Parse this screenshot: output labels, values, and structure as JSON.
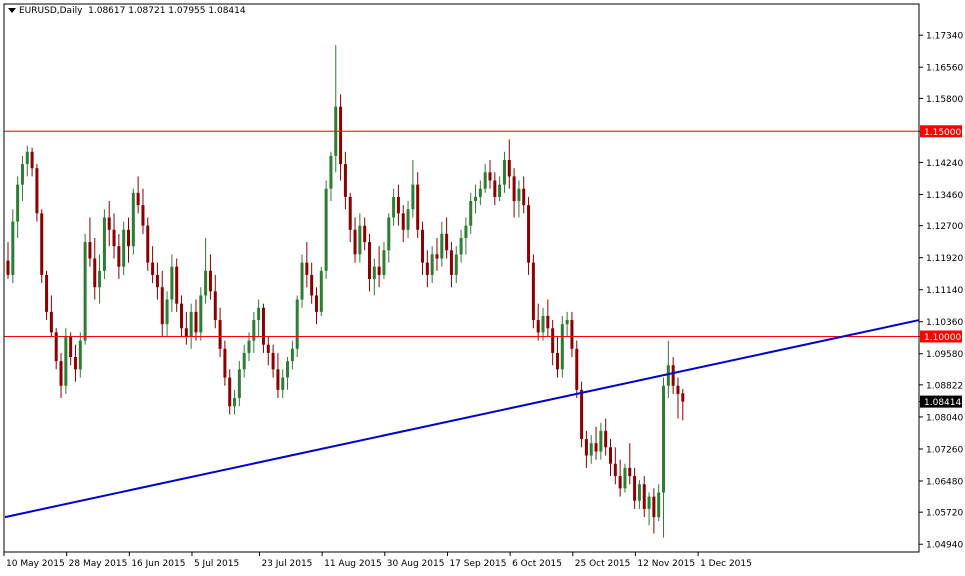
{
  "header": {
    "symbol": "EURUSD,Daily",
    "ohlc": "1.08617 1.08721 1.07955 1.08414"
  },
  "colors": {
    "background": "#ffffff",
    "frame": "#000000",
    "bull": "#2e7d32",
    "bear": "#8b0000",
    "hline": "#ff0000",
    "trendline": "#0000cd",
    "price_tag_bg": "#000000",
    "level_tag_bg": "#ff0000"
  },
  "chart_data": {
    "type": "candlestick",
    "symbol": "EURUSD",
    "timeframe": "Daily",
    "ylim": [
      1.0475,
      1.181
    ],
    "y_ticks": [
      "1.17340",
      "1.16560",
      "1.15800",
      "1.15000",
      "1.14240",
      "1.13460",
      "1.12700",
      "1.11920",
      "1.11140",
      "1.10360",
      "1.10000",
      "1.09580",
      "1.08822",
      "1.08414",
      "1.08040",
      "1.07260",
      "1.06480",
      "1.05720",
      "1.04940"
    ],
    "x_ticks": [
      {
        "label": "10 May 2015",
        "index": 0
      },
      {
        "label": "28 May 2015",
        "index": 13
      },
      {
        "label": "16 Jun 2015",
        "index": 26
      },
      {
        "label": "5 Jul 2015",
        "index": 39
      },
      {
        "label": "23 Jul 2015",
        "index": 53
      },
      {
        "label": "11 Aug 2015",
        "index": 66
      },
      {
        "label": "30 Aug 2015",
        "index": 79
      },
      {
        "label": "17 Sep 2015",
        "index": 92
      },
      {
        "label": "6 Oct 2015",
        "index": 105
      },
      {
        "label": "25 Oct 2015",
        "index": 118
      },
      {
        "label": "12 Nov 2015",
        "index": 131
      },
      {
        "label": "1 Dec 2015",
        "index": 144
      }
    ],
    "horizontal_lines": [
      {
        "value": 1.15,
        "label": "1.15000"
      },
      {
        "value": 1.1,
        "label": "1.10000"
      }
    ],
    "trendline": {
      "from": {
        "index": 0,
        "value": 1.056
      },
      "to": {
        "index": 188,
        "value": 1.104
      }
    },
    "last_price": {
      "value": 1.08414,
      "label": "1.08414"
    },
    "candles": [
      [
        1.1185,
        1.123,
        1.114,
        1.115
      ],
      [
        1.115,
        1.131,
        1.113,
        1.128
      ],
      [
        1.128,
        1.139,
        1.124,
        1.137
      ],
      [
        1.137,
        1.144,
        1.133,
        1.142
      ],
      [
        1.142,
        1.1465,
        1.139,
        1.145
      ],
      [
        1.145,
        1.146,
        1.139,
        1.141
      ],
      [
        1.141,
        1.142,
        1.128,
        1.13
      ],
      [
        1.13,
        1.131,
        1.113,
        1.115
      ],
      [
        1.115,
        1.116,
        1.104,
        1.106
      ],
      [
        1.106,
        1.11,
        1.1,
        1.101
      ],
      [
        1.101,
        1.102,
        1.092,
        1.094
      ],
      [
        1.094,
        1.096,
        1.085,
        1.088
      ],
      [
        1.088,
        1.102,
        1.086,
        1.1
      ],
      [
        1.1,
        1.101,
        1.093,
        1.095
      ],
      [
        1.095,
        1.098,
        1.089,
        1.092
      ],
      [
        1.092,
        1.101,
        1.09,
        1.099
      ],
      [
        1.099,
        1.125,
        1.098,
        1.123
      ],
      [
        1.123,
        1.129,
        1.117,
        1.119
      ],
      [
        1.119,
        1.124,
        1.109,
        1.112
      ],
      [
        1.112,
        1.12,
        1.108,
        1.116
      ],
      [
        1.116,
        1.131,
        1.114,
        1.129
      ],
      [
        1.129,
        1.133,
        1.122,
        1.126
      ],
      [
        1.126,
        1.13,
        1.119,
        1.122
      ],
      [
        1.122,
        1.125,
        1.114,
        1.117
      ],
      [
        1.117,
        1.128,
        1.115,
        1.126
      ],
      [
        1.126,
        1.129,
        1.118,
        1.122
      ],
      [
        1.122,
        1.136,
        1.12,
        1.135
      ],
      [
        1.135,
        1.139,
        1.13,
        1.132
      ],
      [
        1.132,
        1.136,
        1.125,
        1.127
      ],
      [
        1.127,
        1.129,
        1.116,
        1.118
      ],
      [
        1.118,
        1.122,
        1.113,
        1.115
      ],
      [
        1.115,
        1.118,
        1.109,
        1.112
      ],
      [
        1.112,
        1.116,
        1.1,
        1.103
      ],
      [
        1.103,
        1.111,
        1.1,
        1.109
      ],
      [
        1.109,
        1.12,
        1.106,
        1.117
      ],
      [
        1.117,
        1.119,
        1.106,
        1.108
      ],
      [
        1.108,
        1.11,
        1.1,
        1.102
      ],
      [
        1.102,
        1.106,
        1.098,
        1.1
      ],
      [
        1.1,
        1.108,
        1.097,
        1.106
      ],
      [
        1.106,
        1.109,
        1.099,
        1.101
      ],
      [
        1.101,
        1.112,
        1.099,
        1.11
      ],
      [
        1.11,
        1.124,
        1.108,
        1.116
      ],
      [
        1.116,
        1.12,
        1.109,
        1.111
      ],
      [
        1.111,
        1.115,
        1.102,
        1.104
      ],
      [
        1.104,
        1.107,
        1.095,
        1.097
      ],
      [
        1.097,
        1.099,
        1.088,
        1.09
      ],
      [
        1.09,
        1.092,
        1.081,
        1.083
      ],
      [
        1.083,
        1.087,
        1.081,
        1.085
      ],
      [
        1.085,
        1.094,
        1.083,
        1.092
      ],
      [
        1.092,
        1.098,
        1.09,
        1.096
      ],
      [
        1.096,
        1.101,
        1.094,
        1.099
      ],
      [
        1.099,
        1.106,
        1.096,
        1.104
      ],
      [
        1.104,
        1.109,
        1.1,
        1.107
      ],
      [
        1.107,
        1.108,
        1.096,
        1.098
      ],
      [
        1.098,
        1.1,
        1.093,
        1.096
      ],
      [
        1.096,
        1.098,
        1.09,
        1.092
      ],
      [
        1.092,
        1.096,
        1.085,
        1.087
      ],
      [
        1.087,
        1.092,
        1.085,
        1.09
      ],
      [
        1.09,
        1.095,
        1.087,
        1.094
      ],
      [
        1.094,
        1.099,
        1.092,
        1.097
      ],
      [
        1.097,
        1.11,
        1.095,
        1.109
      ],
      [
        1.109,
        1.12,
        1.107,
        1.118
      ],
      [
        1.118,
        1.123,
        1.112,
        1.115
      ],
      [
        1.115,
        1.118,
        1.108,
        1.11
      ],
      [
        1.11,
        1.112,
        1.103,
        1.106
      ],
      [
        1.106,
        1.117,
        1.105,
        1.116
      ],
      [
        1.116,
        1.138,
        1.114,
        1.136
      ],
      [
        1.136,
        1.145,
        1.133,
        1.144
      ],
      [
        1.144,
        1.171,
        1.14,
        1.156
      ],
      [
        1.156,
        1.159,
        1.138,
        1.142
      ],
      [
        1.142,
        1.145,
        1.131,
        1.134
      ],
      [
        1.134,
        1.135,
        1.123,
        1.126
      ],
      [
        1.126,
        1.129,
        1.118,
        1.12
      ],
      [
        1.12,
        1.13,
        1.118,
        1.127
      ],
      [
        1.127,
        1.129,
        1.121,
        1.123
      ],
      [
        1.123,
        1.125,
        1.111,
        1.114
      ],
      [
        1.114,
        1.119,
        1.11,
        1.117
      ],
      [
        1.117,
        1.122,
        1.112,
        1.115
      ],
      [
        1.115,
        1.123,
        1.114,
        1.121
      ],
      [
        1.121,
        1.13,
        1.118,
        1.129
      ],
      [
        1.129,
        1.136,
        1.127,
        1.134
      ],
      [
        1.134,
        1.137,
        1.127,
        1.13
      ],
      [
        1.13,
        1.132,
        1.123,
        1.126
      ],
      [
        1.126,
        1.133,
        1.124,
        1.131
      ],
      [
        1.131,
        1.143,
        1.129,
        1.137
      ],
      [
        1.137,
        1.14,
        1.124,
        1.126
      ],
      [
        1.126,
        1.128,
        1.115,
        1.118
      ],
      [
        1.118,
        1.121,
        1.112,
        1.115
      ],
      [
        1.115,
        1.122,
        1.113,
        1.12
      ],
      [
        1.12,
        1.124,
        1.116,
        1.119
      ],
      [
        1.119,
        1.128,
        1.117,
        1.125
      ],
      [
        1.125,
        1.129,
        1.119,
        1.121
      ],
      [
        1.121,
        1.123,
        1.112,
        1.115
      ],
      [
        1.115,
        1.122,
        1.113,
        1.12
      ],
      [
        1.12,
        1.126,
        1.118,
        1.124
      ],
      [
        1.124,
        1.129,
        1.12,
        1.127
      ],
      [
        1.127,
        1.135,
        1.125,
        1.133
      ],
      [
        1.133,
        1.137,
        1.13,
        1.134
      ],
      [
        1.134,
        1.138,
        1.132,
        1.136
      ],
      [
        1.136,
        1.142,
        1.135,
        1.14
      ],
      [
        1.14,
        1.143,
        1.136,
        1.138
      ],
      [
        1.138,
        1.14,
        1.132,
        1.134
      ],
      [
        1.134,
        1.139,
        1.133,
        1.137
      ],
      [
        1.137,
        1.145,
        1.135,
        1.143
      ],
      [
        1.143,
        1.148,
        1.136,
        1.139
      ],
      [
        1.139,
        1.141,
        1.129,
        1.133
      ],
      [
        1.133,
        1.138,
        1.129,
        1.136
      ],
      [
        1.136,
        1.139,
        1.13,
        1.132
      ],
      [
        1.132,
        1.134,
        1.115,
        1.118
      ],
      [
        1.118,
        1.12,
        1.102,
        1.104
      ],
      [
        1.104,
        1.108,
        1.099,
        1.101
      ],
      [
        1.101,
        1.107,
        1.099,
        1.105
      ],
      [
        1.105,
        1.109,
        1.1,
        1.102
      ],
      [
        1.102,
        1.104,
        1.093,
        1.096
      ],
      [
        1.096,
        1.1,
        1.09,
        1.092
      ],
      [
        1.092,
        1.105,
        1.09,
        1.103
      ],
      [
        1.103,
        1.106,
        1.1,
        1.104
      ],
      [
        1.104,
        1.106,
        1.095,
        1.097
      ],
      [
        1.097,
        1.099,
        1.085,
        1.087
      ],
      [
        1.087,
        1.089,
        1.073,
        1.075
      ],
      [
        1.075,
        1.077,
        1.068,
        1.071
      ],
      [
        1.071,
        1.076,
        1.069,
        1.074
      ],
      [
        1.074,
        1.078,
        1.07,
        1.072
      ],
      [
        1.072,
        1.079,
        1.07,
        1.077
      ],
      [
        1.077,
        1.08,
        1.071,
        1.073
      ],
      [
        1.073,
        1.075,
        1.066,
        1.069
      ],
      [
        1.069,
        1.073,
        1.064,
        1.066
      ],
      [
        1.066,
        1.07,
        1.061,
        1.063
      ],
      [
        1.063,
        1.069,
        1.062,
        1.068
      ],
      [
        1.068,
        1.074,
        1.064,
        1.066
      ],
      [
        1.066,
        1.068,
        1.058,
        1.06
      ],
      [
        1.06,
        1.065,
        1.058,
        1.064
      ],
      [
        1.064,
        1.066,
        1.056,
        1.058
      ],
      [
        1.058,
        1.062,
        1.054,
        1.061
      ],
      [
        1.061,
        1.063,
        1.052,
        1.056
      ],
      [
        1.056,
        1.064,
        1.055,
        1.062
      ],
      [
        1.062,
        1.09,
        1.051,
        1.088
      ],
      [
        1.088,
        1.099,
        1.085,
        1.093
      ],
      [
        1.093,
        1.095,
        1.086,
        1.088
      ],
      [
        1.088,
        1.09,
        1.08,
        1.086
      ],
      [
        1.08617,
        1.08721,
        1.07955,
        1.08414
      ]
    ]
  }
}
